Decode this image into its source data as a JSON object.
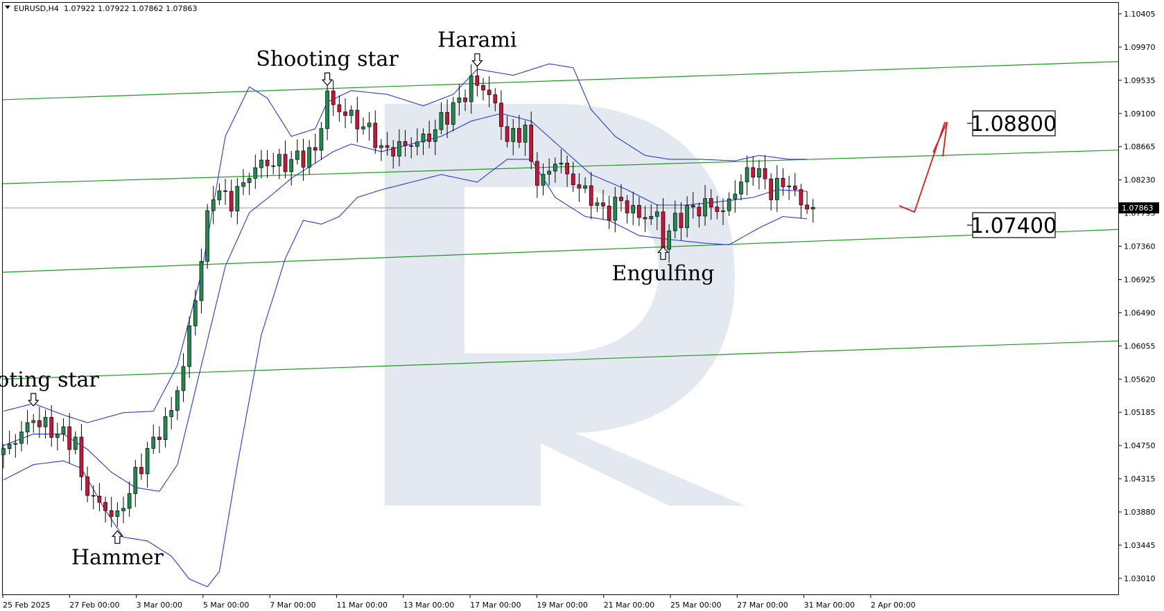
{
  "header": {
    "symbol": "EURUSD,H4",
    "ohlc": "1.07922 1.07922 1.07862 1.07863"
  },
  "colors": {
    "bull": "#1e8c4f",
    "bear": "#c8153a",
    "bollinger": "#2a36e0",
    "channel": "#1c9a1c",
    "current_line": "#9a9a9a",
    "arrow": "#e01a1a",
    "watermark": "#dfe4ef",
    "grid_axis": "#000000"
  },
  "chart_data": {
    "type": "candlestick",
    "ylim": [
      1.028,
      1.1055
    ],
    "y_ticks": [
      "1.10405",
      "1.09970",
      "1.09535",
      "1.09100",
      "1.08665",
      "1.08230",
      "1.07795",
      "1.07360",
      "1.06925",
      "1.06490",
      "1.06055",
      "1.05620",
      "1.05185",
      "1.04750",
      "1.04315",
      "1.03880",
      "1.03445",
      "1.03010"
    ],
    "x_ticks": [
      "25 Feb 2025",
      "27 Feb 00:00",
      "3 Mar 00:00",
      "5 Mar 00:00",
      "7 Mar 00:00",
      "11 Mar 00:00",
      "13 Mar 00:00",
      "17 Mar 00:00",
      "19 Mar 00:00",
      "21 Mar 00:00",
      "25 Mar 00:00",
      "27 Mar 00:00",
      "31 Mar 00:00",
      "2 Apr 00:00"
    ],
    "current_price": "1.07863",
    "levels": [
      "1.08800",
      "1.07400"
    ],
    "annotations": [
      {
        "text": "Shooting star",
        "candle": 54,
        "y": 1.0945,
        "pos": "above"
      },
      {
        "text": "Harami",
        "candle": 79,
        "y": 1.097,
        "pos": "above"
      },
      {
        "text": "Engulfing",
        "candle": 110,
        "y": 1.0737,
        "pos": "below"
      },
      {
        "text": "ooting star",
        "candle": 5,
        "y": 1.0525,
        "pos": "above"
      },
      {
        "text": "Hammer",
        "candle": 19,
        "y": 1.0365,
        "pos": "below"
      }
    ],
    "anchors": [
      [
        0,
        1.0465
      ],
      [
        5,
        1.051
      ],
      [
        8,
        1.0495
      ],
      [
        12,
        1.048
      ],
      [
        13,
        1.043
      ],
      [
        15,
        1.0405
      ],
      [
        17,
        1.0392
      ],
      [
        19,
        1.038
      ],
      [
        20,
        1.04
      ],
      [
        21,
        1.0415
      ],
      [
        23,
        1.0452
      ],
      [
        25,
        1.048
      ],
      [
        28,
        1.052
      ],
      [
        30,
        1.058
      ],
      [
        32,
        1.067
      ],
      [
        34,
        1.077
      ],
      [
        35,
        1.081
      ],
      [
        38,
        1.0795
      ],
      [
        41,
        1.083
      ],
      [
        43,
        1.0845
      ],
      [
        47,
        1.0845
      ],
      [
        52,
        1.086
      ],
      [
        54,
        1.0935
      ],
      [
        55,
        1.092
      ],
      [
        58,
        1.0905
      ],
      [
        62,
        1.088
      ],
      [
        63,
        1.086
      ],
      [
        68,
        1.087
      ],
      [
        71,
        1.088
      ],
      [
        74,
        1.091
      ],
      [
        76,
        1.0925
      ],
      [
        78,
        1.095
      ],
      [
        80,
        1.0945
      ],
      [
        82,
        1.092
      ],
      [
        84,
        1.0875
      ],
      [
        87,
        1.089
      ],
      [
        88,
        1.084
      ],
      [
        90,
        1.082
      ],
      [
        92,
        1.085
      ],
      [
        95,
        1.082
      ],
      [
        98,
        1.08
      ],
      [
        100,
        1.078
      ],
      [
        103,
        1.0795
      ],
      [
        106,
        1.0775
      ],
      [
        109,
        1.0775
      ],
      [
        110,
        1.074
      ],
      [
        112,
        1.077
      ],
      [
        115,
        1.0785
      ],
      [
        118,
        1.079
      ],
      [
        120,
        1.078
      ],
      [
        122,
        1.081
      ],
      [
        125,
        1.084
      ],
      [
        128,
        1.081
      ],
      [
        131,
        1.082
      ],
      [
        133,
        1.079
      ],
      [
        135,
        1.0787
      ]
    ],
    "bollinger": {
      "upper": [
        [
          0,
          1.052
        ],
        [
          5,
          1.053
        ],
        [
          10,
          1.0515
        ],
        [
          14,
          1.0505
        ],
        [
          20,
          1.0518
        ],
        [
          25,
          1.052
        ],
        [
          29,
          1.058
        ],
        [
          33,
          1.07
        ],
        [
          37,
          1.088
        ],
        [
          41,
          1.0945
        ],
        [
          44,
          1.093
        ],
        [
          48,
          1.088
        ],
        [
          52,
          1.089
        ],
        [
          54,
          1.0925
        ],
        [
          58,
          1.094
        ],
        [
          64,
          1.0935
        ],
        [
          70,
          1.092
        ],
        [
          75,
          1.0935
        ],
        [
          79,
          1.0968
        ],
        [
          85,
          1.096
        ],
        [
          91,
          1.0975
        ],
        [
          95,
          1.097
        ],
        [
          98,
          1.0915
        ],
        [
          102,
          1.088
        ],
        [
          107,
          1.0855
        ],
        [
          111,
          1.085
        ],
        [
          116,
          1.085
        ],
        [
          122,
          1.0848
        ],
        [
          126,
          1.0855
        ],
        [
          131,
          1.085
        ],
        [
          134,
          1.085
        ]
      ],
      "middle": [
        [
          0,
          1.0475
        ],
        [
          5,
          1.049
        ],
        [
          10,
          1.049
        ],
        [
          14,
          1.047
        ],
        [
          18,
          1.044
        ],
        [
          22,
          1.042
        ],
        [
          26,
          1.0415
        ],
        [
          29,
          1.045
        ],
        [
          33,
          1.058
        ],
        [
          37,
          1.071
        ],
        [
          41,
          1.078
        ],
        [
          45,
          1.0805
        ],
        [
          48,
          1.0825
        ],
        [
          52,
          1.0845
        ],
        [
          55,
          1.086
        ],
        [
          58,
          1.087
        ],
        [
          63,
          1.086
        ],
        [
          68,
          1.087
        ],
        [
          73,
          1.088
        ],
        [
          78,
          1.09
        ],
        [
          83,
          1.091
        ],
        [
          88,
          1.09
        ],
        [
          93,
          1.0865
        ],
        [
          98,
          1.083
        ],
        [
          104,
          1.081
        ],
        [
          109,
          1.079
        ],
        [
          114,
          1.079
        ],
        [
          120,
          1.0795
        ],
        [
          125,
          1.08
        ],
        [
          129,
          1.081
        ],
        [
          134,
          1.0808
        ]
      ],
      "lower": [
        [
          0,
          1.043
        ],
        [
          5,
          1.045
        ],
        [
          10,
          1.0455
        ],
        [
          13,
          1.0445
        ],
        [
          17,
          1.039
        ],
        [
          20,
          1.0355
        ],
        [
          24,
          1.035
        ],
        [
          28,
          1.033
        ],
        [
          31,
          1.03
        ],
        [
          34,
          1.029
        ],
        [
          36,
          1.031
        ],
        [
          39,
          1.045
        ],
        [
          43,
          1.062
        ],
        [
          47,
          1.072
        ],
        [
          50,
          1.077
        ],
        [
          53,
          1.0765
        ],
        [
          56,
          1.0775
        ],
        [
          59,
          1.08
        ],
        [
          63,
          1.081
        ],
        [
          68,
          1.082
        ],
        [
          73,
          1.083
        ],
        [
          79,
          1.082
        ],
        [
          84,
          1.085
        ],
        [
          88,
          1.085
        ],
        [
          92,
          1.08
        ],
        [
          97,
          1.0775
        ],
        [
          101,
          1.077
        ],
        [
          106,
          1.075
        ],
        [
          111,
          1.0745
        ],
        [
          117,
          1.074
        ],
        [
          121,
          1.0738
        ],
        [
          126,
          1.076
        ],
        [
          130,
          1.0775
        ],
        [
          134,
          1.0772
        ]
      ]
    },
    "channel_lines": [
      [
        1.0928,
        1.0978
      ],
      [
        1.0818,
        1.0862
      ],
      [
        1.0702,
        1.0758
      ],
      [
        1.0562,
        1.0612
      ]
    ]
  }
}
